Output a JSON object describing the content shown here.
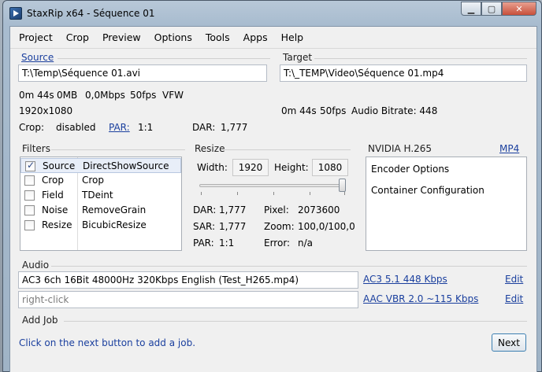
{
  "window": {
    "title": "StaxRip x64 - Séquence 01"
  },
  "menu": [
    "Project",
    "Crop",
    "Preview",
    "Options",
    "Tools",
    "Apps",
    "Help"
  ],
  "source": {
    "label": "Source",
    "path": "T:\\Temp\\Séquence 01.avi",
    "duration": "0m 44s",
    "size": "0MB",
    "bitrate": "0,0Mbps",
    "fps": "50fps",
    "format": "VFW",
    "resolution": "1920x1080",
    "crop_label": "Crop:",
    "crop_value": "disabled",
    "par_label": "PAR:",
    "par_value": "1:1",
    "dar_label": "DAR:",
    "dar_value": "1,777"
  },
  "target": {
    "label": "Target",
    "path": "T:\\_TEMP\\Video\\Séquence 01.mp4",
    "duration": "0m 44s",
    "fps": "50fps",
    "audio_bitrate": "Audio Bitrate: 448"
  },
  "filters": {
    "label": "Filters",
    "items": [
      {
        "name": "Source",
        "value": "DirectShowSource",
        "checked": true
      },
      {
        "name": "Crop",
        "value": "Crop",
        "checked": false
      },
      {
        "name": "Field",
        "value": "TDeint",
        "checked": false
      },
      {
        "name": "Noise",
        "value": "RemoveGrain",
        "checked": false
      },
      {
        "name": "Resize",
        "value": "BicubicResize",
        "checked": false
      }
    ]
  },
  "resize": {
    "label": "Resize",
    "width_label": "Width:",
    "width_value": "1920",
    "height_label": "Height:",
    "height_value": "1080",
    "slider_level": 1.0,
    "dar_label": "DAR:",
    "dar_value": "1,777",
    "pixel_label": "Pixel:",
    "pixel_value": "2073600",
    "sar_label": "SAR:",
    "sar_value": "1,777",
    "zoom_label": "Zoom:",
    "zoom_value": "100,0/100,0",
    "par_label": "PAR:",
    "par_value": "1:1",
    "error_label": "Error:",
    "error_value": "n/a"
  },
  "encoder": {
    "label": "NVIDIA H.265",
    "container_link": "MP4",
    "items": [
      "Encoder Options",
      "Container Configuration"
    ]
  },
  "audio": {
    "label": "Audio",
    "track1": "AC3 6ch 16Bit 48000Hz 320Kbps English (Test_H265.mp4)",
    "track1_profile": "AC3 5.1 448 Kbps",
    "track2_placeholder": "right-click",
    "track2_profile": "AAC VBR 2.0 ~115 Kbps",
    "edit_label": "Edit"
  },
  "addjob": {
    "label": "Add Job",
    "hint": "Click on the next button to add a job.",
    "next_label": "Next"
  }
}
